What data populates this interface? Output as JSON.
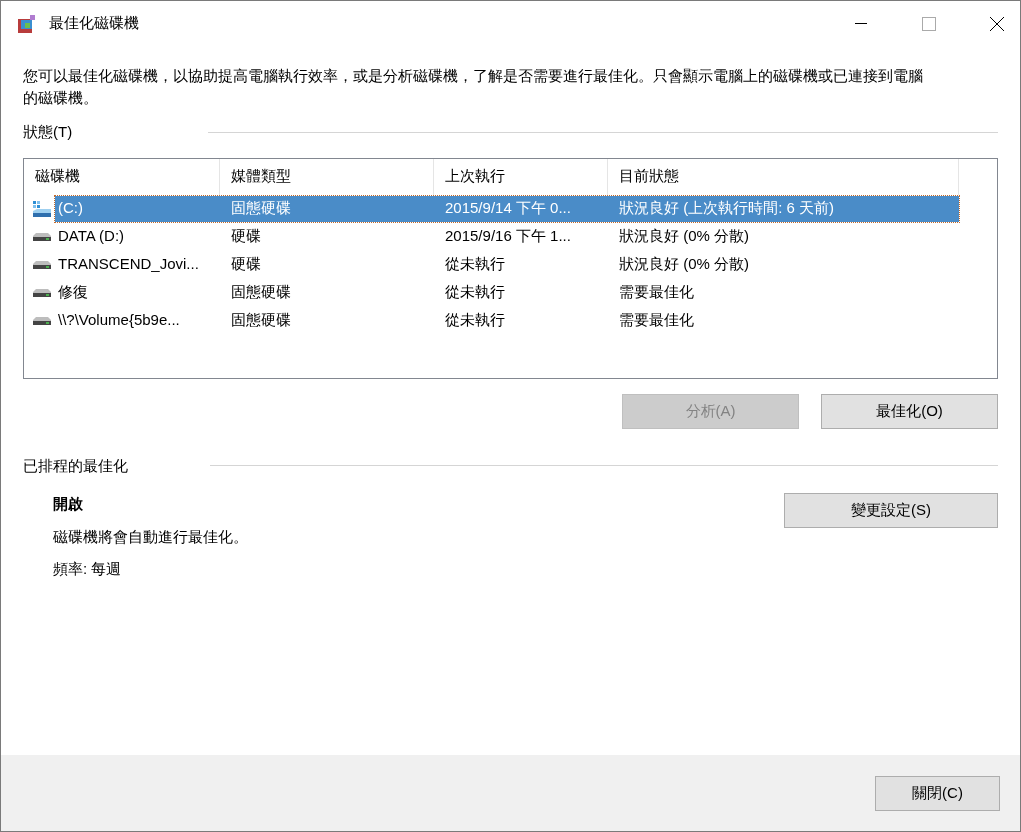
{
  "window": {
    "title": "最佳化磁碟機"
  },
  "description": "您可以最佳化磁碟機，以協助提高電腦執行效率，或是分析磁碟機，了解是否需要進行最佳化。只會顯示電腦上的磁碟機或已連接到電腦的磁碟機。",
  "status": {
    "heading": "狀態(T)",
    "table": {
      "columns": [
        "磁碟機",
        "媒體類型",
        "上次執行",
        "目前狀態"
      ],
      "rows": [
        {
          "kind": "system",
          "selected": true,
          "cells": [
            "(C:)",
            "固態硬碟",
            "2015/9/14 下午 0...",
            "狀況良好 (上次執行時間: 6 天前)"
          ]
        },
        {
          "kind": "drive",
          "selected": false,
          "cells": [
            "DATA (D:)",
            "硬碟",
            "2015/9/16 下午 1...",
            "狀況良好 (0% 分散)"
          ]
        },
        {
          "kind": "drive",
          "selected": false,
          "cells": [
            "TRANSCEND_Jovi...",
            "硬碟",
            "從未執行",
            "狀況良好 (0% 分散)"
          ]
        },
        {
          "kind": "drive",
          "selected": false,
          "cells": [
            "修復",
            "固態硬碟",
            "從未執行",
            "需要最佳化"
          ]
        },
        {
          "kind": "drive",
          "selected": false,
          "cells": [
            "\\\\?\\Volume{5b9e...",
            "固態硬碟",
            "從未執行",
            "需要最佳化"
          ]
        }
      ]
    },
    "buttons": [
      {
        "label": "分析(A)",
        "disabled": true
      },
      {
        "label": "最佳化(O)",
        "disabled": false
      }
    ]
  },
  "schedule": {
    "heading": "已排程的最佳化",
    "state": "開啟",
    "note": "磁碟機將會自動進行最佳化。",
    "frequency": "頻率: 每週",
    "button": "變更設定(S)"
  },
  "footer": {
    "button": "關閉(C)"
  }
}
